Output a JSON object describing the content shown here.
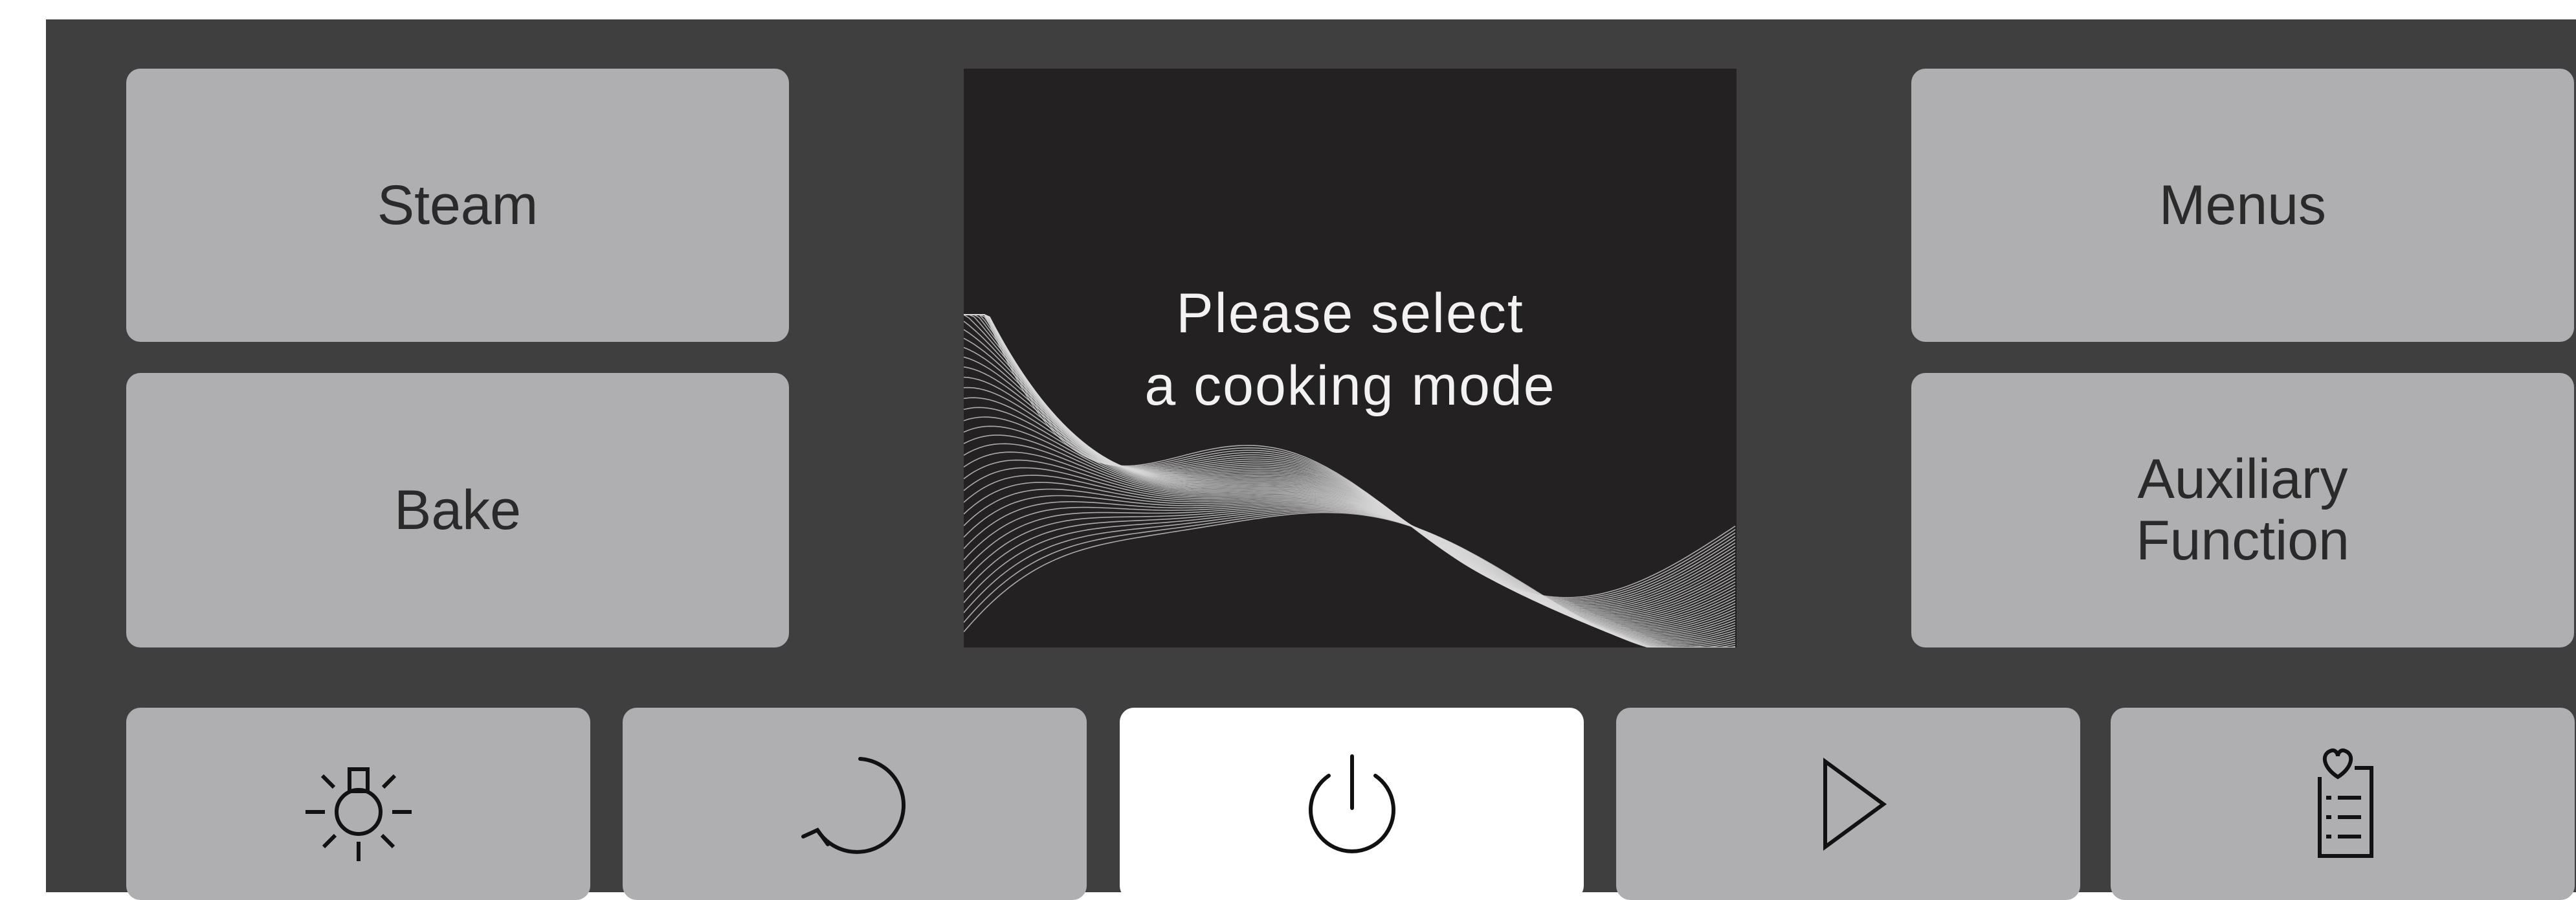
{
  "controls": {
    "steam_label": "Steam",
    "bake_label": "Bake",
    "menus_label": "Menus",
    "auxiliary_label_line1": "Auxiliary",
    "auxiliary_label_line2": "Function"
  },
  "display": {
    "message_line1": "Please select",
    "message_line2": "a cooking mode"
  },
  "bottom_bar": {
    "icons": [
      "light-icon",
      "rotate-icon",
      "power-icon",
      "play-icon",
      "favorites-list-icon"
    ],
    "active": "power-icon"
  },
  "colors": {
    "panel": "#3f3f3f",
    "button": "#afafb2",
    "button_active": "#ffffff",
    "display_bg": "#232122",
    "text": "#2a2a2a",
    "display_text": "#f2f2f2"
  }
}
